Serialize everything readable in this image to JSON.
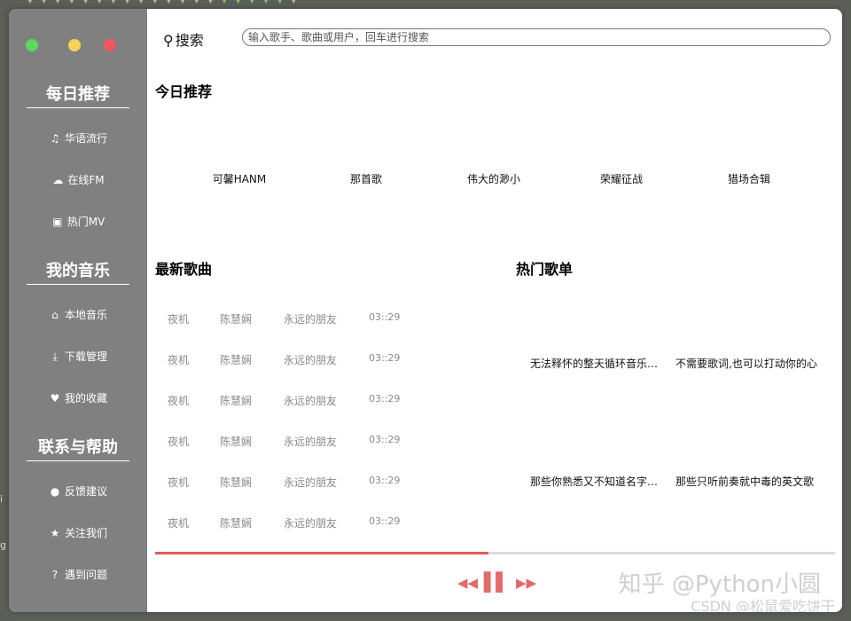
{
  "window": {
    "traffic_lights": [
      {
        "name": "green",
        "color": "#5cd85c"
      },
      {
        "name": "yellow",
        "color": "#f6d25b"
      },
      {
        "name": "red",
        "color": "#f0575e"
      }
    ]
  },
  "sidebar": {
    "sections": [
      {
        "title": "每日推荐",
        "items": [
          {
            "label": "华语流行",
            "icon": "music-note-icon",
            "glyph": "♫"
          },
          {
            "label": "在线FM",
            "icon": "cloud-icon",
            "glyph": "☁"
          },
          {
            "label": "热门MV",
            "icon": "film-icon",
            "glyph": "▣"
          }
        ]
      },
      {
        "title": "我的音乐",
        "items": [
          {
            "label": "本地音乐",
            "icon": "home-icon",
            "glyph": "⌂"
          },
          {
            "label": "下载管理",
            "icon": "download-icon",
            "glyph": "⤓"
          },
          {
            "label": "我的收藏",
            "icon": "heart-icon",
            "glyph": "♥"
          }
        ]
      },
      {
        "title": "联系与帮助",
        "items": [
          {
            "label": "反馈建议",
            "icon": "comment-icon",
            "glyph": "●"
          },
          {
            "label": "关注我们",
            "icon": "star-icon",
            "glyph": "★"
          },
          {
            "label": "遇到问题",
            "icon": "question-icon",
            "glyph": "?"
          }
        ]
      }
    ]
  },
  "search": {
    "label": "搜索",
    "placeholder": "输入歌手、歌曲或用户，回车进行搜索"
  },
  "today": {
    "title": "今日推荐",
    "items": [
      "可馨HANM",
      "那首歌",
      "伟大的渺小",
      "荣耀征战",
      "猎场合辑"
    ]
  },
  "newest": {
    "title": "最新歌曲",
    "rows": [
      {
        "song": "夜机",
        "artist": "陈慧娴",
        "album": "永远的朋友",
        "duration": "03::29"
      },
      {
        "song": "夜机",
        "artist": "陈慧娴",
        "album": "永远的朋友",
        "duration": "03::29"
      },
      {
        "song": "夜机",
        "artist": "陈慧娴",
        "album": "永远的朋友",
        "duration": "03::29"
      },
      {
        "song": "夜机",
        "artist": "陈慧娴",
        "album": "永远的朋友",
        "duration": "03::29"
      },
      {
        "song": "夜机",
        "artist": "陈慧娴",
        "album": "永远的朋友",
        "duration": "03::29"
      },
      {
        "song": "夜机",
        "artist": "陈慧娴",
        "album": "永远的朋友",
        "duration": "03::29"
      }
    ]
  },
  "hot": {
    "title": "热门歌单",
    "items": [
      "无法释怀的整天循环音乐…",
      "不需要歌词,也可以打动你的心",
      "那些你熟悉又不知道名字…",
      "那些只听前奏就中毒的英文歌"
    ]
  },
  "player": {
    "progress": 0.49,
    "accent": "#e05b5b",
    "controls": [
      "prev",
      "pause",
      "next"
    ]
  },
  "watermarks": {
    "zhihu": "知乎 @Python小圆",
    "csdn": "CSDN @松鼠爱吃饼干"
  }
}
